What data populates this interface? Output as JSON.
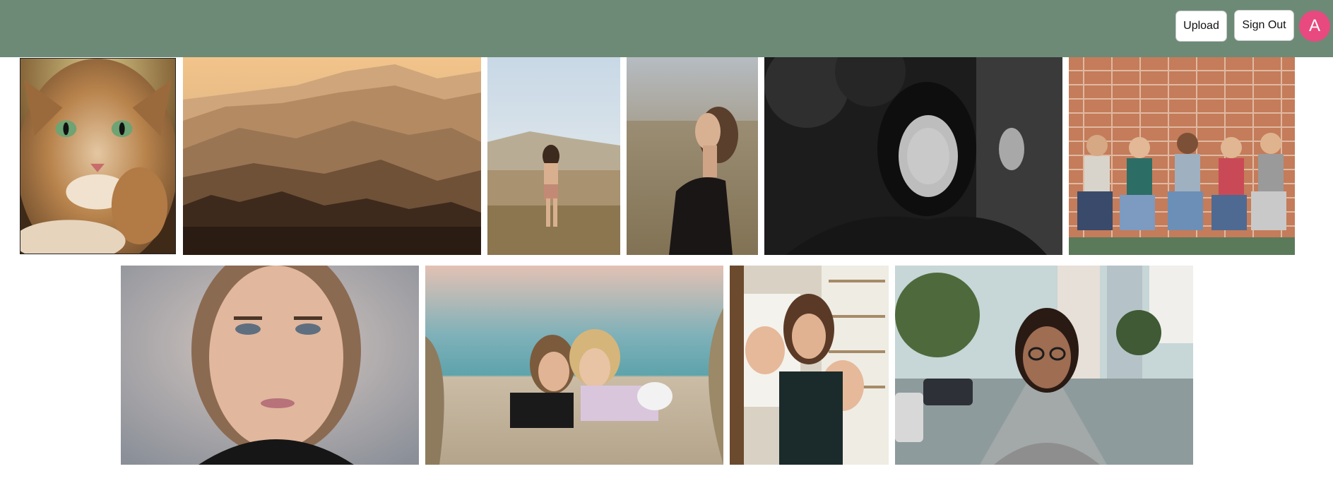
{
  "header": {
    "background": "#6d8a76",
    "upload_label": "Upload",
    "signout_label": "Sign Out",
    "avatar_initial": "A",
    "avatar_color": "#e8497f"
  },
  "gallery": {
    "row1": [
      {
        "subject": "tabby cat with green eyes"
      },
      {
        "subject": "misty mountain ridges"
      },
      {
        "subject": "woman walking in grass field"
      },
      {
        "subject": "woman profile in dune grass"
      },
      {
        "subject": "black and white portrait of woman"
      },
      {
        "subject": "group of five friends against brick wall"
      }
    ],
    "row2": [
      {
        "subject": "close-up portrait of woman"
      },
      {
        "subject": "two women lying on sand"
      },
      {
        "subject": "woman with painted hands"
      },
      {
        "subject": "smiling woman with glasses on street"
      }
    ]
  }
}
